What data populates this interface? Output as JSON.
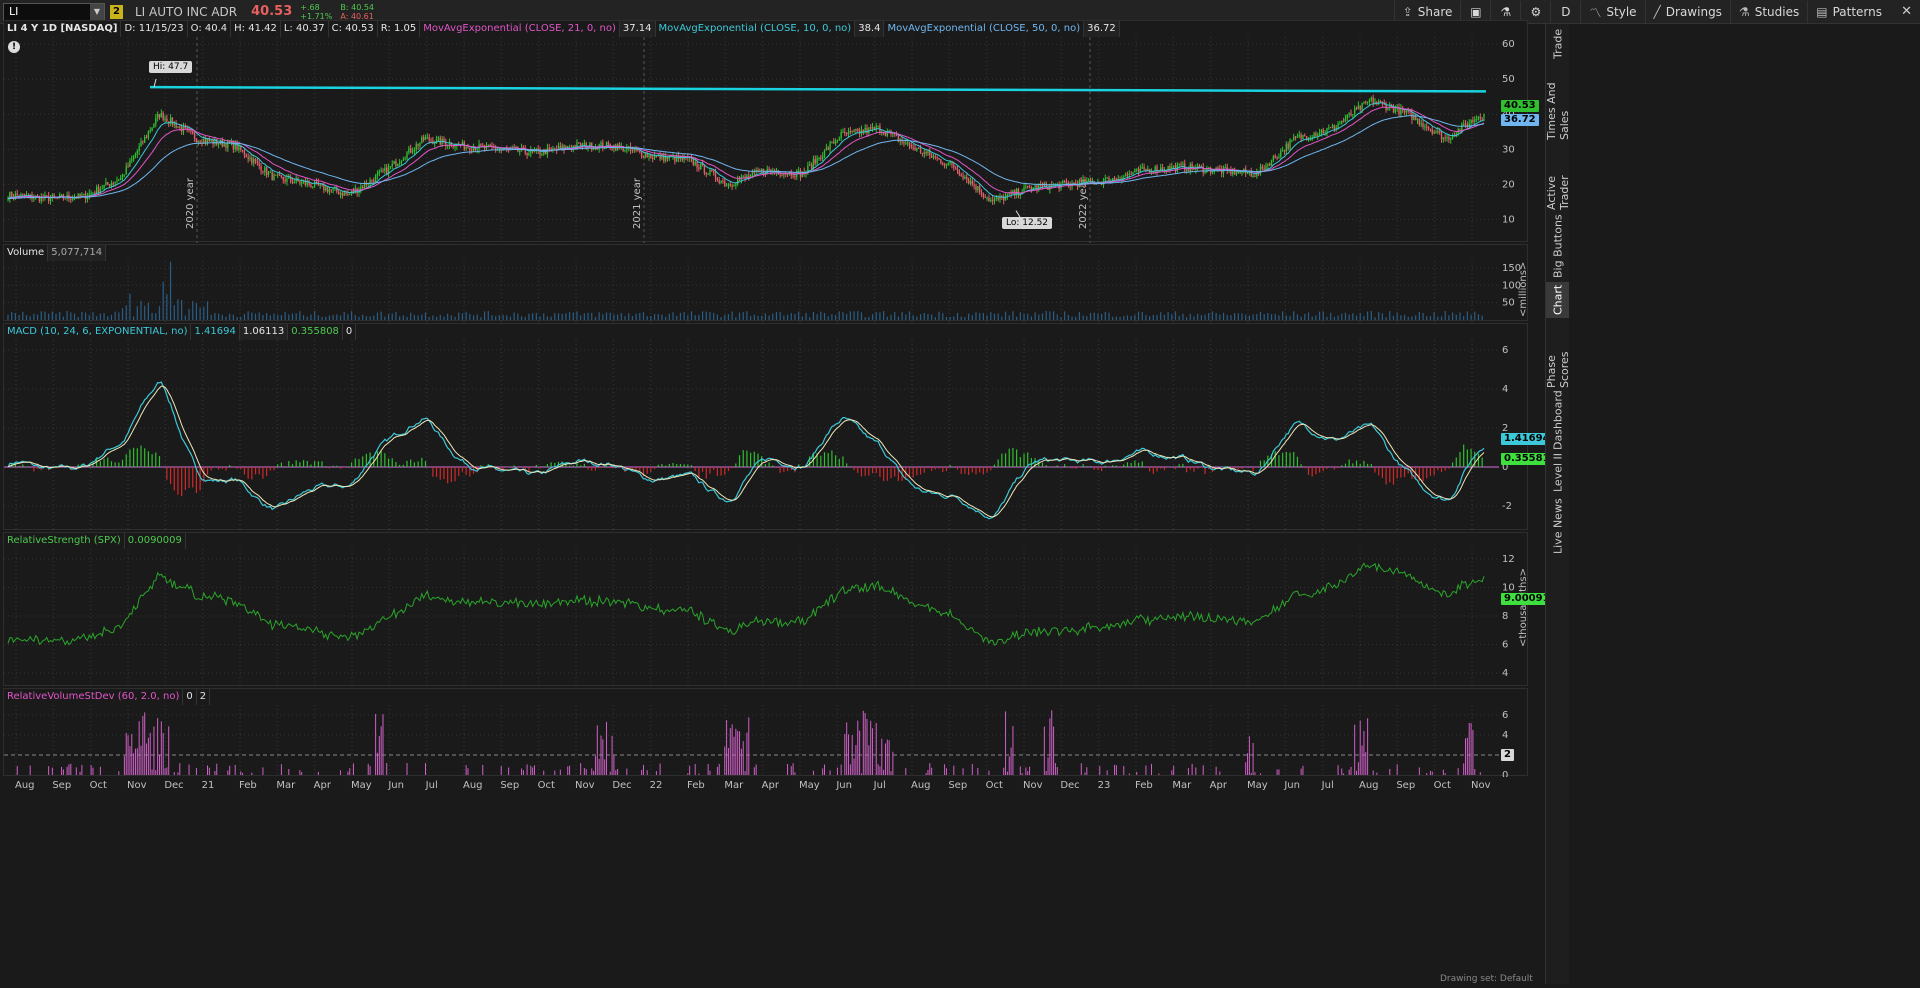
{
  "toolbar": {
    "symbol": "LI",
    "link_badge": "2",
    "company": "LI AUTO INC ADR",
    "last": "40.53",
    "change": "+.68",
    "change_pct": "+1.71%",
    "bid": "B: 40.54",
    "ask": "A: 40.61",
    "buttons": {
      "share": "Share",
      "aggregation": "D",
      "style": "Style",
      "drawings": "Drawings",
      "studies": "Studies",
      "patterns": "Patterns"
    }
  },
  "price_panel": {
    "title": "LI 4 Y 1D [NASDAQ]",
    "date": "D: 11/15/23",
    "open": "O: 40.4",
    "high": "H: 41.42",
    "low": "L: 40.37",
    "close": "C: 40.53",
    "range": "R: 1.05",
    "ema21_label": "MovAvgExponential (CLOSE, 21, 0, no)",
    "ema21_value": "37.14",
    "ema10_label": "MovAvgExponential (CLOSE, 10, 0, no)",
    "ema10_value": "38.4",
    "ema50_label": "MovAvgExponential (CLOSE, 50, 0, no)",
    "ema50_value": "36.72",
    "hi_bubble": "Hi: 47.7",
    "lo_bubble": "Lo: 12.52",
    "last_tag": "40.53",
    "ema50_tag": "36.72",
    "year_labels": [
      "2020 year",
      "2021 year",
      "2022 year"
    ],
    "y_ticks": [
      "60",
      "50",
      "40",
      "30",
      "20",
      "10"
    ],
    "colors": {
      "up": "#2fbf2f",
      "down": "#e0606a",
      "ema10": "#3cc8d8",
      "ema21": "#e056c8",
      "ema50": "#6fb6f0",
      "trendline": "#19d3e0"
    }
  },
  "volume_panel": {
    "label": "Volume",
    "value": "5,077,714",
    "y_ticks": [
      "150",
      "100",
      "50"
    ],
    "unit": "<millions>"
  },
  "macd_panel": {
    "label": "MACD (10, 24, 6, EXPONENTIAL, no)",
    "value": "1.41694",
    "avg": "1.06113",
    "diff": "0.355808",
    "zero": "0",
    "y_ticks": [
      "6",
      "4",
      "2",
      "0",
      "-2"
    ],
    "value_tag": "1.41694",
    "diff_tag": "0.35581"
  },
  "rs_panel": {
    "label": "RelativeStrength (SPX)",
    "value": "0.0090009",
    "y_ticks": [
      "12",
      "10",
      "8",
      "6",
      "4"
    ],
    "unit": "<thousandths>",
    "value_tag": "9.00091"
  },
  "rvsd_panel": {
    "label": "RelativeVolumeStDev (60, 2.0, no)",
    "v1": "0",
    "v2": "2",
    "y_ticks": [
      "6",
      "4",
      "2",
      "0"
    ],
    "tag": "2"
  },
  "time_axis": [
    "Aug",
    "Sep",
    "Oct",
    "Nov",
    "Dec",
    "21",
    "Feb",
    "Mar",
    "Apr",
    "May",
    "Jun",
    "Jul",
    "Aug",
    "Sep",
    "Oct",
    "Nov",
    "Dec",
    "22",
    "Feb",
    "Mar",
    "Apr",
    "May",
    "Jun",
    "Jul",
    "Aug",
    "Sep",
    "Oct",
    "Nov",
    "Dec",
    "23",
    "Feb",
    "Mar",
    "Apr",
    "May",
    "Jun",
    "Jul",
    "Aug",
    "Sep",
    "Oct",
    "Nov"
  ],
  "side_tabs": [
    "Trade",
    "Times And Sales",
    "Active Trader",
    "Big Buttons",
    "Chart",
    "Phase Scores",
    "Dashboard",
    "Level II",
    "Live News"
  ],
  "status": "Drawing set: Default",
  "chart_data": {
    "type": "candlestick",
    "series": [
      {
        "name": "Close (approx)",
        "x": [
          "2020-08",
          "2020-09",
          "2020-10",
          "2020-11",
          "2020-12",
          "2021-01",
          "2021-02",
          "2021-03",
          "2021-04",
          "2021-05",
          "2021-06",
          "2021-07",
          "2021-08",
          "2021-09",
          "2021-10",
          "2021-11",
          "2021-12",
          "2022-01",
          "2022-02",
          "2022-03",
          "2022-04",
          "2022-05",
          "2022-06",
          "2022-07",
          "2022-08",
          "2022-09",
          "2022-10",
          "2022-11",
          "2022-12",
          "2023-01",
          "2023-02",
          "2023-03",
          "2023-04",
          "2023-05",
          "2023-06",
          "2023-07",
          "2023-08",
          "2023-09",
          "2023-10",
          "2023-11"
        ],
        "values": [
          17,
          16,
          16.5,
          22,
          40,
          33,
          31,
          22,
          20,
          17,
          24,
          33,
          31,
          30,
          29,
          31,
          31,
          28,
          27,
          20,
          24,
          23,
          34,
          36,
          30,
          25,
          15,
          19,
          20,
          21,
          24,
          25,
          24,
          23,
          33,
          36,
          44,
          40,
          33,
          40.5
        ]
      }
    ],
    "hi": 47.7,
    "lo": 12.52,
    "ylim": [
      5,
      62
    ]
  }
}
